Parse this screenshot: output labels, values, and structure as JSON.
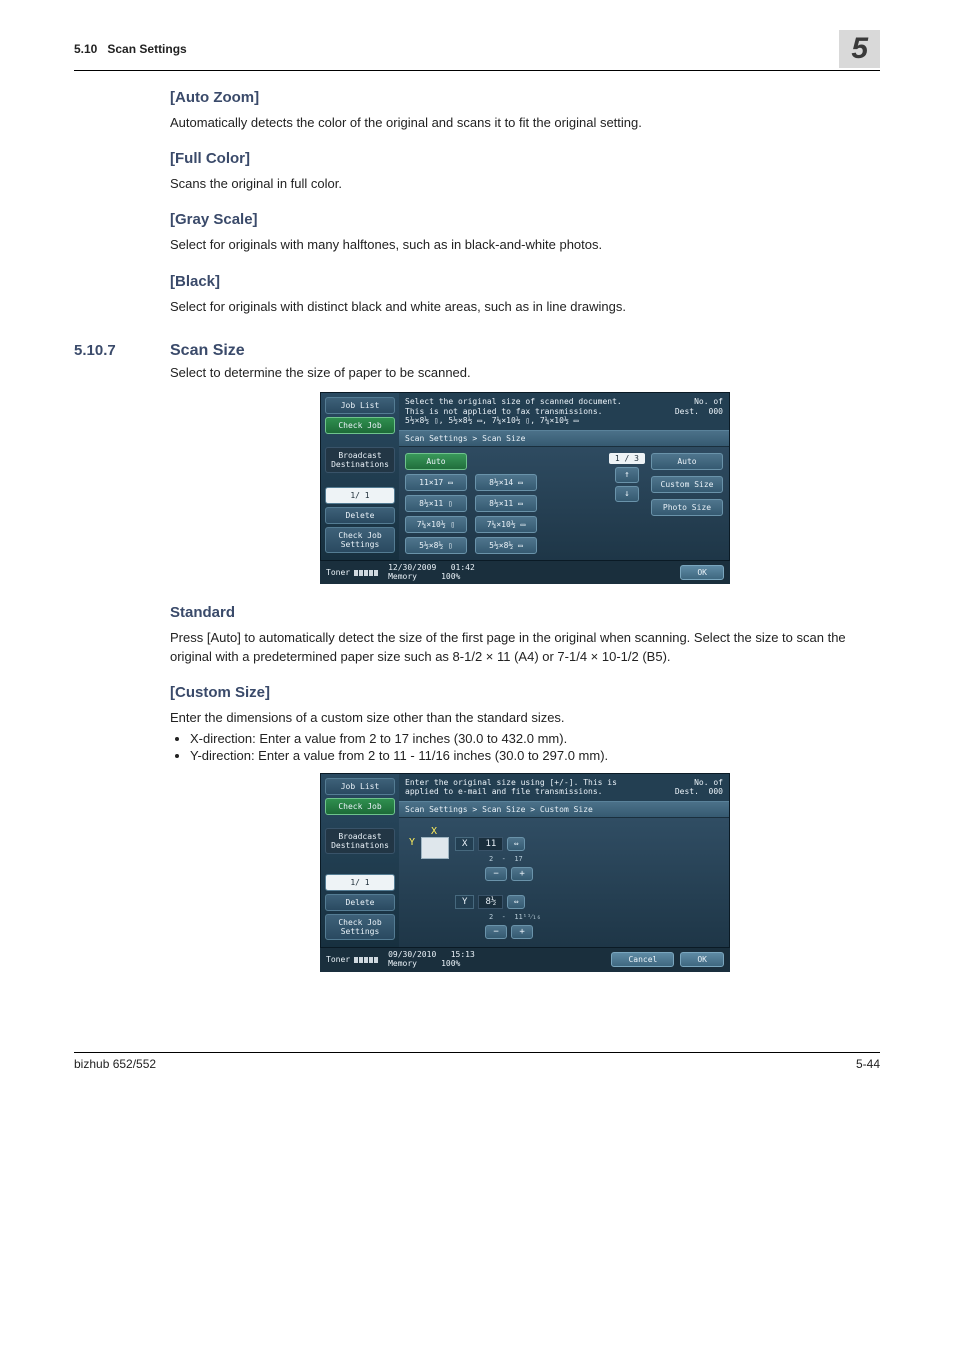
{
  "header": {
    "section_no": "5.10",
    "section_title": "Scan Settings",
    "chapter_big": "5"
  },
  "sections": {
    "auto_zoom": {
      "title": "[Auto Zoom]",
      "text": "Automatically detects the color of the original and scans it to fit the original setting."
    },
    "full_color": {
      "title": "[Full Color]",
      "text": "Scans the original in full color."
    },
    "gray_scale": {
      "title": "[Gray Scale]",
      "text": "Select for originals with many halftones, such as in black-and-white photos."
    },
    "black": {
      "title": "[Black]",
      "text": "Select for originals with distinct black and white areas, such as in line drawings."
    },
    "scan_size": {
      "num": "5.10.7",
      "title": "Scan Size",
      "text": "Select to determine the size of paper to be scanned."
    },
    "standard": {
      "title": "Standard",
      "text": "Press [Auto] to automatically detect the size of the first page in the original when scanning. Select the size to scan the original with a predetermined paper size such as 8-1/2 × 11 (A4) or 7-1/4 × 10-1/2 (B5)."
    },
    "custom_size": {
      "title": "[Custom Size]",
      "text": "Enter the dimensions of a custom size other than the standard sizes.",
      "bullets": [
        "X-direction: Enter a value from 2 to 17 inches (30.0 to 432.0 mm).",
        "Y-direction: Enter a value from 2 to 11 - 11/16 inches (30.0 to 297.0 mm)."
      ]
    }
  },
  "panel1": {
    "left": {
      "job_list": "Job List",
      "check_job": "Check Job",
      "broadcast": "Broadcast\nDestinations",
      "pager": "1/  1",
      "delete": "Delete",
      "cjs": "Check Job\nSettings"
    },
    "msg": "Select the original size of scanned document.\nThis is not applied to fax transmissions.",
    "msg_icons": "5½×8½ ▯, 5½×8½ ▭, 7¼×10½ ▯, 7¼×10½ ▭",
    "dest_label": "No. of\nDest.",
    "dest_val": "000",
    "crumb": "Scan Settings > Scan Size",
    "sizes_col1": [
      "Auto",
      "11×17 ▭",
      "8½×11 ▯",
      "7¼×10½ ▯",
      "5½×8½ ▯"
    ],
    "sizes_col2": [
      "",
      "8½×14 ▭",
      "8½×11 ▭",
      "7¼×10½ ▭",
      "5½×8½ ▭"
    ],
    "page_ind": "1 / 3",
    "side": [
      "Auto",
      "Custom Size",
      "Photo Size"
    ],
    "status": {
      "toner": "Toner",
      "date": "12/30/2009",
      "time": "01:42",
      "mem": "Memory",
      "mem_val": "100%",
      "ok": "OK"
    }
  },
  "panel2": {
    "left": {
      "job_list": "Job List",
      "check_job": "Check Job",
      "broadcast": "Broadcast\nDestinations",
      "pager": "1/  1",
      "delete": "Delete",
      "cjs": "Check Job\nSettings"
    },
    "msg": "Enter the original size using [+/-]. This is\napplied to e-mail and file transmissions.",
    "dest_label": "No. of\nDest.",
    "dest_val": "000",
    "crumb": "Scan Settings > Scan Size > Custom Size",
    "x_lab": "X",
    "y_lab": "Y",
    "x_val": "11",
    "x_range_lo": "2",
    "x_range_hi": "17",
    "y_val": "8½",
    "y_range_lo": "2",
    "y_range_hi": "11¹¹⁄₁₆",
    "arrows": "⇔",
    "minus": "−",
    "plus": "+",
    "status": {
      "toner": "Toner",
      "date": "09/30/2010",
      "time": "15:13",
      "mem": "Memory",
      "mem_val": "100%",
      "cancel": "Cancel",
      "ok": "OK"
    }
  },
  "footer": {
    "model": "bizhub 652/552",
    "page": "5-44"
  }
}
